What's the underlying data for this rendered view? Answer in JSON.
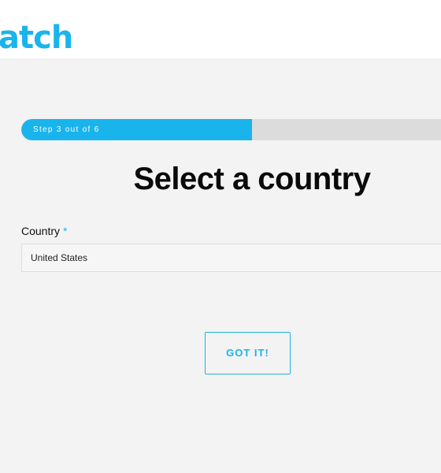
{
  "brand": {
    "logo_text": "atch",
    "accent_color": "#1ab4ec"
  },
  "progress": {
    "label": "Step 3 out of 6",
    "current_step": 3,
    "total_steps": 6,
    "fraction_complete": 0.5
  },
  "main": {
    "title": "Select a country"
  },
  "form": {
    "country_label": "Country",
    "required_marker": "*",
    "country_value": "United States"
  },
  "actions": {
    "confirm_label": "GOT IT!"
  }
}
